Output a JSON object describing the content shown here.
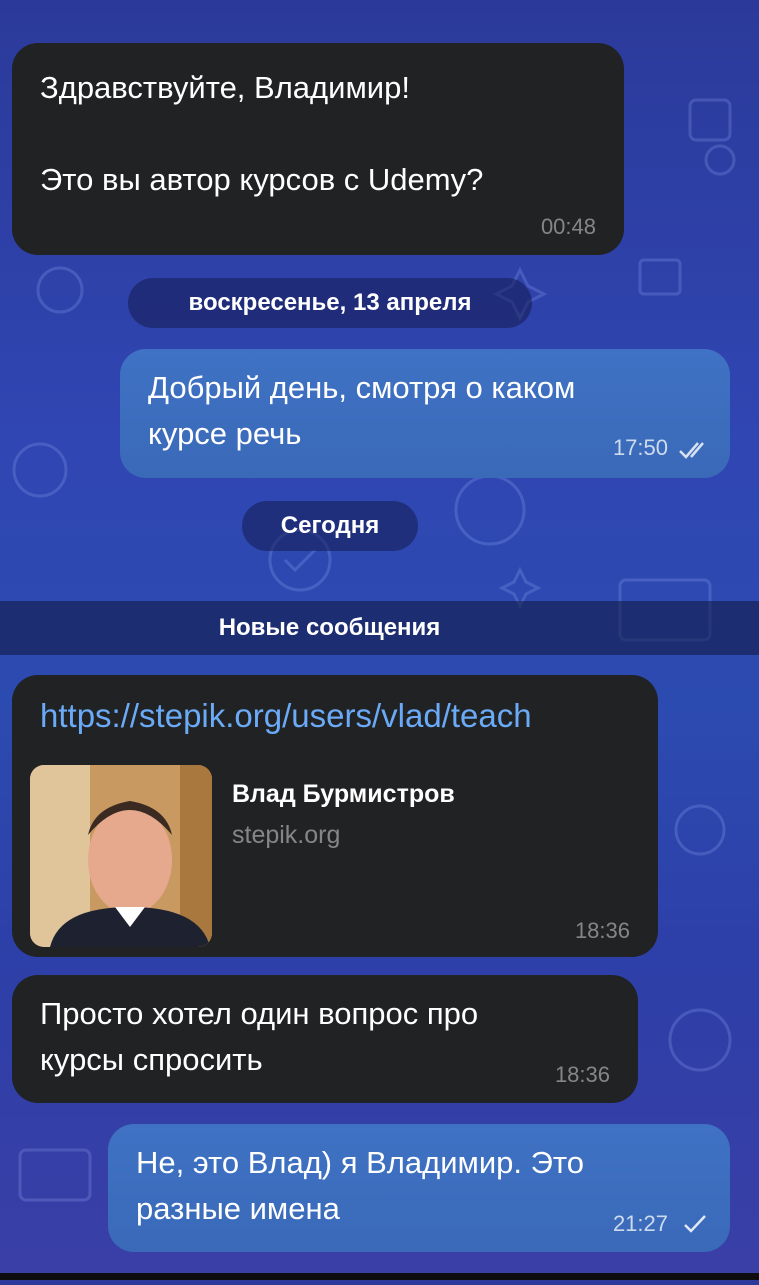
{
  "messages": [
    {
      "id": "m1",
      "direction": "incoming",
      "text": "Здравствуйте, Владимир!\n\nЭто вы автор курсов с Udemy?",
      "time": "00:48"
    },
    {
      "id": "m2",
      "direction": "outgoing",
      "text": "Добрый день, смотря о каком\nкурсе речь",
      "time": "17:50",
      "status": "read"
    },
    {
      "id": "m3",
      "direction": "incoming",
      "link": "https://stepik.org/users/vlad/teach",
      "preview": {
        "title": "Влад Бурмистров",
        "site": "stepik.org"
      },
      "time": "18:36"
    },
    {
      "id": "m4",
      "direction": "incoming",
      "text": "Просто хотел один вопрос про\nкурсы спросить",
      "time": "18:36"
    },
    {
      "id": "m5",
      "direction": "outgoing",
      "text": "Не, это Влад) я Владимир. Это\nразные имена",
      "time": "21:27",
      "status": "sent"
    }
  ],
  "date_separators": {
    "sunday": "воскресенье, 13 апреля",
    "today": "Сегодня"
  },
  "new_messages_label": "Новые сообщения",
  "colors": {
    "incoming_bubble": "#212224",
    "outgoing_bubble": "#3f6fc0",
    "link": "#6aaaf7"
  },
  "icons": {
    "read_status": "double-check-icon",
    "sent_status": "check-icon"
  }
}
